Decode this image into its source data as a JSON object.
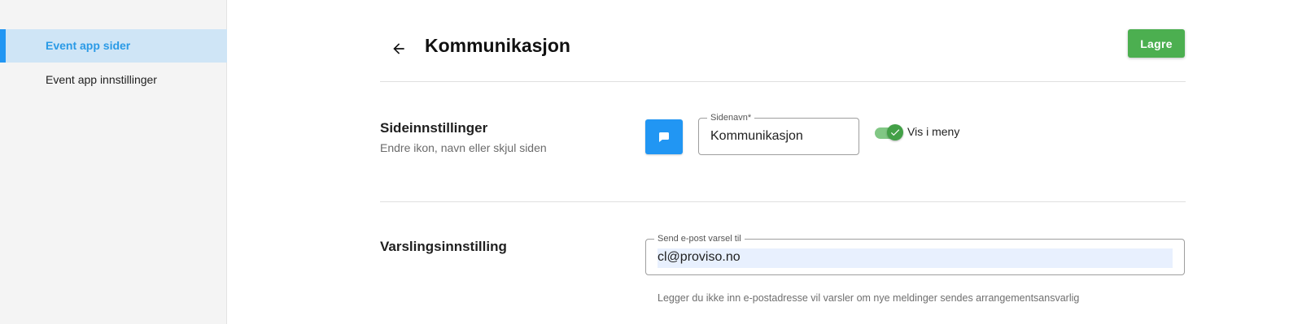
{
  "sidebar": {
    "items": [
      {
        "label": "Event app sider",
        "active": true
      },
      {
        "label": "Event app innstillinger",
        "active": false
      }
    ]
  },
  "header": {
    "back_icon": "arrow-left-icon",
    "title": "Kommunikasjon",
    "save_label": "Lagre"
  },
  "page_settings": {
    "title": "Sideinnstillinger",
    "subtitle": "Endre ikon, navn eller skjul siden",
    "icon": "chat-bubble-icon",
    "page_name_label": "Sidenavn*",
    "page_name_value": "Kommunikasjon",
    "show_in_menu_label": "Vis i meny",
    "show_in_menu": true
  },
  "notification_settings": {
    "title": "Varslingsinnstilling",
    "email_label": "Send e-post varsel til",
    "email_value": "cl@proviso.no",
    "helper_text": "Legger du ikke inn e-postadresse vil varsler om nye meldinger sendes arrangementsansvarlig"
  },
  "colors": {
    "accent": "#2196f3",
    "save": "#4caf50",
    "toggle": "#43a047"
  }
}
